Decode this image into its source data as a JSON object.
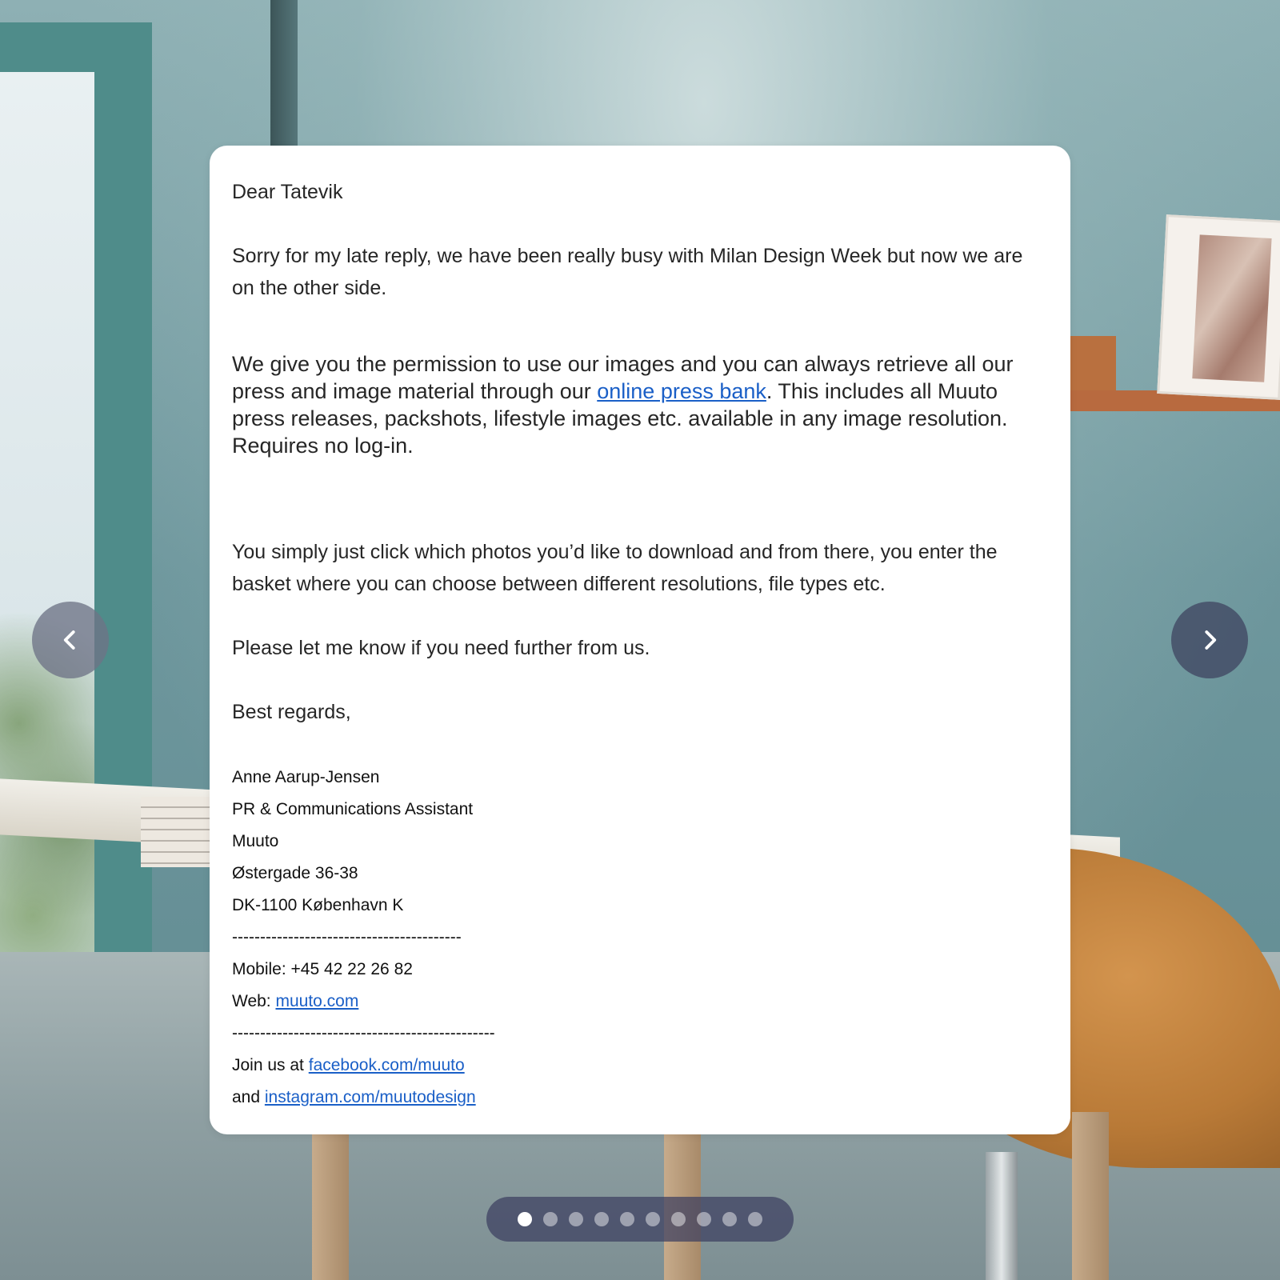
{
  "email": {
    "greeting": "Dear Tatevik",
    "para1": "Sorry for my late reply, we have been really busy with Milan Design Week but now we are on the other side.",
    "para2_before_link": "We give you the permission to use our images and you can always retrieve all our press and image material through our ",
    "para2_link": "online press bank",
    "para2_after_link": ". This includes all Muuto press releases, packshots, lifestyle images etc. available in any image resolution. Requires no log-in.",
    "para3": "You simply just click which photos you’d like to download and from there, you enter the basket where you can choose between different resolutions, file types etc.",
    "para4": "Please let me know if you need further from us.",
    "closing": "Best regards,",
    "signature": {
      "name": "Anne Aarup-Jensen",
      "title": "PR & Communications Assistant",
      "company": "Muuto",
      "street": "Østergade 36-38",
      "city": "DK-1100 København K",
      "divider1": "-----------------------------------------",
      "mobile": "Mobile: +45 42 22 26 82",
      "web_label": "Web: ",
      "web_link": "muuto.com",
      "divider2": "-----------------------------------------------",
      "join_label": "Join us at ",
      "facebook_link": "facebook.com/muuto",
      "and_label": "and ",
      "instagram_link": "instagram.com/muutodesign"
    }
  },
  "carousel": {
    "prev_icon": "chevron-left-icon",
    "next_icon": "chevron-right-icon",
    "total_slides": 10,
    "active_slide": 1
  },
  "colors": {
    "link": "#1a5fc7",
    "card_bg": "#ffffff"
  }
}
